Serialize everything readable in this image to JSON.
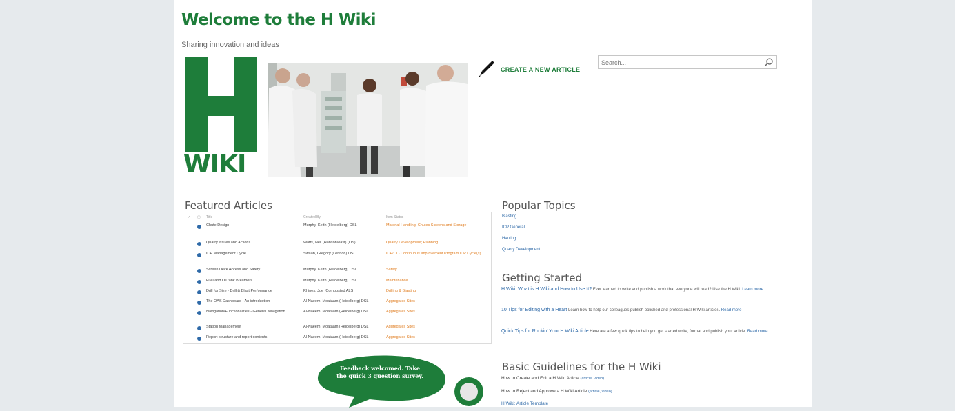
{
  "header": {
    "title": "Welcome to the H Wiki",
    "subtitle": "Sharing innovation and ideas"
  },
  "logo": {
    "wiki_text": "WIKI"
  },
  "create_article": {
    "label": "CREATE A NEW ARTICLE",
    "icon": "pen-icon"
  },
  "search": {
    "placeholder": "Search...",
    "icon": "search-icon"
  },
  "featured": {
    "heading": "Featured Articles",
    "columns": [
      "Title",
      "Created By",
      "Item Status"
    ],
    "rows": [
      {
        "title": "Chute Design",
        "author": "Murphy, Keith (Heidelberg) DSL",
        "tags": "Material Handling; Chutes Screens and Storage"
      },
      {
        "title": "Quarry Issues and Actions",
        "author": "Watts, Neil (Hanson/east) (OS)",
        "tags": "Quarry Development; Planning"
      },
      {
        "title": "ICP Management Cycle",
        "author": "Swaab, Gregory (Lennon) DSL",
        "tags": "ICP/CI - Continuous Improvement Program ICP Cycle(s)"
      },
      {
        "title": "Screen Deck Access and Safety",
        "author": "Murphy, Keith (Heidelberg) DSL",
        "tags": "Safety"
      },
      {
        "title": "Fuel and Oil tank Breathers",
        "author": "Murphy, Keith (Heidelberg) DSL",
        "tags": "Maintenance"
      },
      {
        "title": "Drill for Size - Drill & Blast Performance",
        "author": "Rhines, Joe (Composted ALS",
        "tags": "Drilling & Blasting"
      },
      {
        "title": "The OAS Dashboard - An introduction",
        "author": "Al-Naeem, Moataam (Heidelberg) DSL",
        "tags": "Aggregates Sites"
      },
      {
        "title": "Navigation/Functionalities - General Navigation",
        "author": "Al-Naeem, Moataam (Heidelberg) DSL",
        "tags": "Aggregates Sites"
      },
      {
        "title": "Station Management",
        "author": "Al-Naeem, Moataam (Heidelberg) DSL",
        "tags": "Aggregates Sites"
      },
      {
        "title": "Report structure and report contents",
        "author": "Al-Naeem, Moataam (Heidelberg) DSL",
        "tags": "Aggregates Sites"
      }
    ]
  },
  "popular": {
    "heading": "Popular Topics",
    "items": [
      "Blasting",
      "ICP General",
      "Hauling",
      "Quarry Development"
    ]
  },
  "getting_started": {
    "heading": "Getting Started",
    "items": [
      {
        "title": "H Wiki: What is H Wiki and How to Use It?",
        "desc": "Ever learned to write and publish a work that everyone will read? Use the H Wiki.",
        "more": "Learn more"
      },
      {
        "title": "10 Tips for Editing with a Heart",
        "desc": "Learn how to help our colleagues publish polished and professional H Wiki articles.",
        "more": "Read more"
      },
      {
        "title": "Quick Tips for Rockin' Your H Wiki Article",
        "desc": "Here are a few quick tips to help you get started write, format and publish your article.",
        "more": "Read more"
      }
    ]
  },
  "guidelines": {
    "heading": "Basic Guidelines for the H Wiki",
    "items": [
      {
        "label": "How to Create and Edit a H Wiki Article",
        "sub": "(article, video)"
      },
      {
        "label": "How to Reject and Approve a H Wiki Article",
        "sub": "(article, video)"
      },
      {
        "label": "H Wiki: Article Template",
        "sub": ""
      }
    ]
  },
  "feedback": {
    "text": "Feedback welcomed. Take the quick 3 question survey."
  },
  "colors": {
    "brand": "#1e7d3a",
    "link": "#2f6aa8",
    "tag": "#e07e22",
    "frame": "#e6eaed"
  }
}
